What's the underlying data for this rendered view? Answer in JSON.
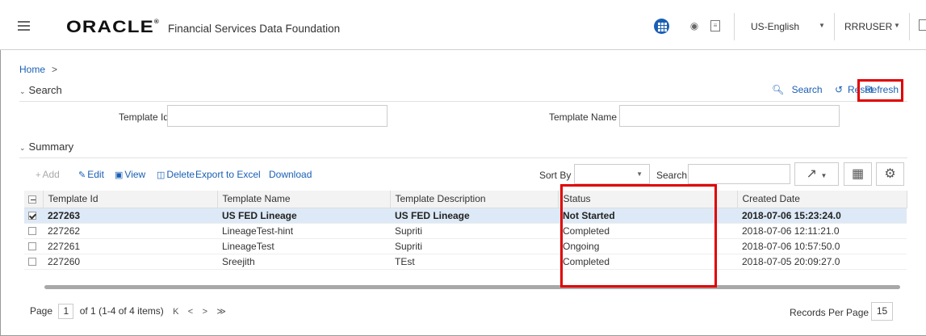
{
  "header": {
    "brand": "ORACLE",
    "brand_mark": "®",
    "product": "Financial Services Data Foundation",
    "language": "US-English",
    "user": "RRRUSER",
    "apps_icon": "apps-grid-icon",
    "bug_icon": "bug-icon",
    "book_icon": "book-icon"
  },
  "breadcrumb": {
    "home": "Home",
    "separator": ">"
  },
  "search_section": {
    "title": "Search",
    "search_link": "Search",
    "reset_link": "Reset",
    "refresh_link": "Refresh",
    "template_id_label": "Template Id",
    "template_id_value": "",
    "template_name_label": "Template Name",
    "template_name_value": ""
  },
  "summary_section": {
    "title": "Summary",
    "toolbar": {
      "add": "Add",
      "edit": "Edit",
      "view": "View",
      "delete": "Delete",
      "export": "Export to Excel",
      "download": "Download",
      "sort_by_label": "Sort By",
      "sort_by_value": "",
      "search_label": "Search",
      "search_value": ""
    },
    "columns": [
      "Template Id",
      "Template Name",
      "Template Description",
      "Status",
      "Created Date"
    ],
    "rows": [
      {
        "id": "227263",
        "name": "US FED Lineage",
        "description": "US FED Lineage",
        "status": "Not Started",
        "created": "2018-07-06 15:23:24.0",
        "selected": true
      },
      {
        "id": "227262",
        "name": "LineageTest-hint",
        "description": "Supriti",
        "status": "Completed",
        "created": "2018-07-06 12:11:21.0",
        "selected": false
      },
      {
        "id": "227261",
        "name": "LineageTest",
        "description": "Supriti",
        "status": "Ongoing",
        "created": "2018-07-06 10:57:50.0",
        "selected": false
      },
      {
        "id": "227260",
        "name": "Sreejith",
        "description": "TEst",
        "status": "Completed",
        "created": "2018-07-05 20:09:27.0",
        "selected": false
      }
    ]
  },
  "pager": {
    "page_label": "Page",
    "page_value": "1",
    "page_info": "of 1 (1-4 of 4 items)",
    "records_per_page_label": "Records Per Page",
    "records_per_page_value": "15"
  },
  "colors": {
    "link": "#1a5fb4",
    "highlight_box": "#e00000",
    "selected_row": "#dde9f7"
  }
}
